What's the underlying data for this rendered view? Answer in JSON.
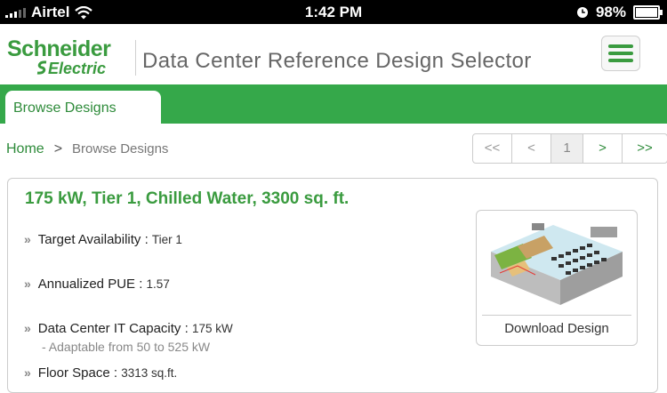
{
  "status_bar": {
    "carrier": "Airtel",
    "time": "1:42 PM",
    "battery": "98%"
  },
  "header": {
    "logo_top": "Schneider",
    "logo_bottom": "Electric",
    "title": "Data Center Reference Design Selector"
  },
  "tabs": [
    {
      "label": "Browse Designs"
    }
  ],
  "breadcrumb": {
    "home": "Home",
    "separator": ">",
    "current": "Browse Designs"
  },
  "pager": {
    "first": "<<",
    "prev": "<",
    "page": "1",
    "next": ">",
    "last": ">>"
  },
  "design": {
    "title": "175 kW, Tier 1, Chilled Water, 3300 sq. ft.",
    "bullet": "»",
    "specs": [
      {
        "label": "Target Availability : ",
        "value": "Tier 1"
      },
      {
        "label": "Annualized PUE : ",
        "value": "1.57"
      },
      {
        "label": "Data Center IT Capacity : ",
        "value": "175 kW",
        "note": "- Adaptable from 50 to 525 kW"
      },
      {
        "label": "Floor Space : ",
        "value": "3313 sq.ft."
      }
    ],
    "download_label": "Download Design"
  },
  "colors": {
    "brand_green": "#3a9b3f",
    "tab_bar": "#35a84a"
  }
}
